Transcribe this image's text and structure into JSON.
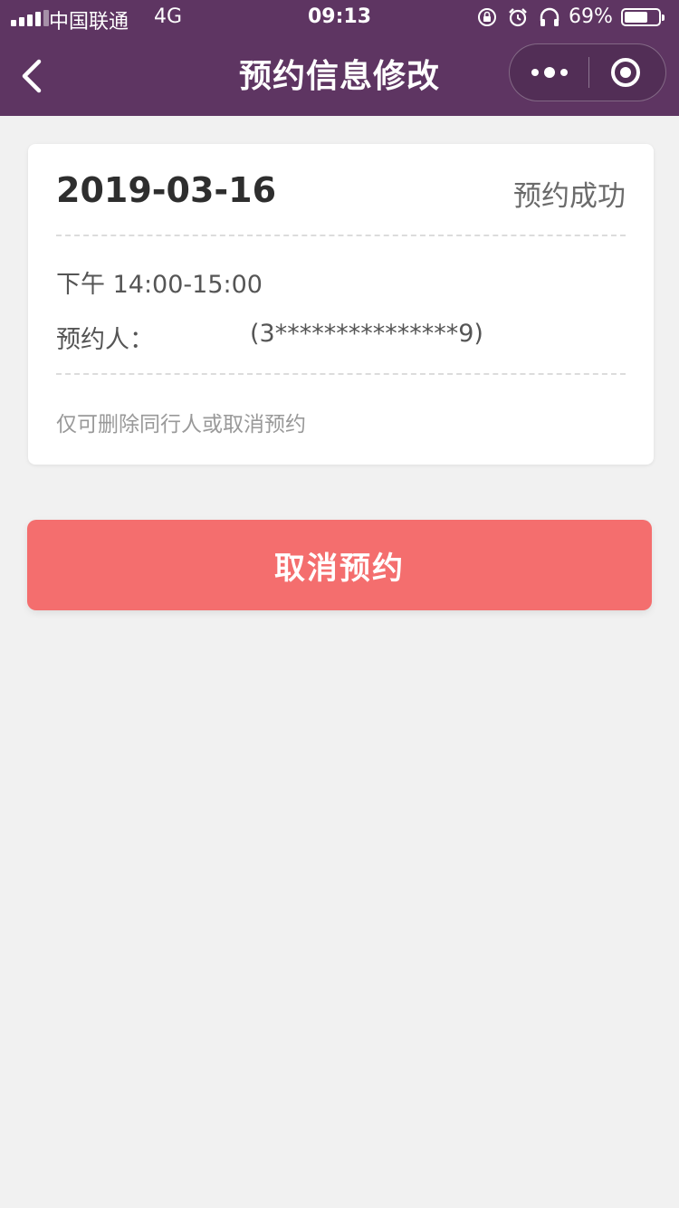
{
  "status_bar": {
    "carrier": "中国联通",
    "network": "4G",
    "time": "09:13",
    "battery_percent_text": "69%",
    "battery_level": 0.69,
    "icons": [
      "signal-icon",
      "orientation-lock-icon",
      "alarm-icon",
      "headphones-icon",
      "battery-icon"
    ]
  },
  "nav": {
    "title": "预约信息修改",
    "back_icon": "chevron-left-icon",
    "more_icon": "more-dots-icon",
    "close_icon": "target-circle-icon"
  },
  "booking": {
    "date": "2019-03-16",
    "status": "预约成功",
    "time_slot": "下午 14:00-15:00",
    "person_label": "预约人：",
    "person_id": "(3***************9)",
    "note": "仅可删除同行人或取消预约"
  },
  "actions": {
    "cancel_label": "取消预约"
  },
  "colors": {
    "header_bg": "#5e3562",
    "page_bg": "#f1f1f1",
    "cancel_button": "#f46e6e"
  }
}
